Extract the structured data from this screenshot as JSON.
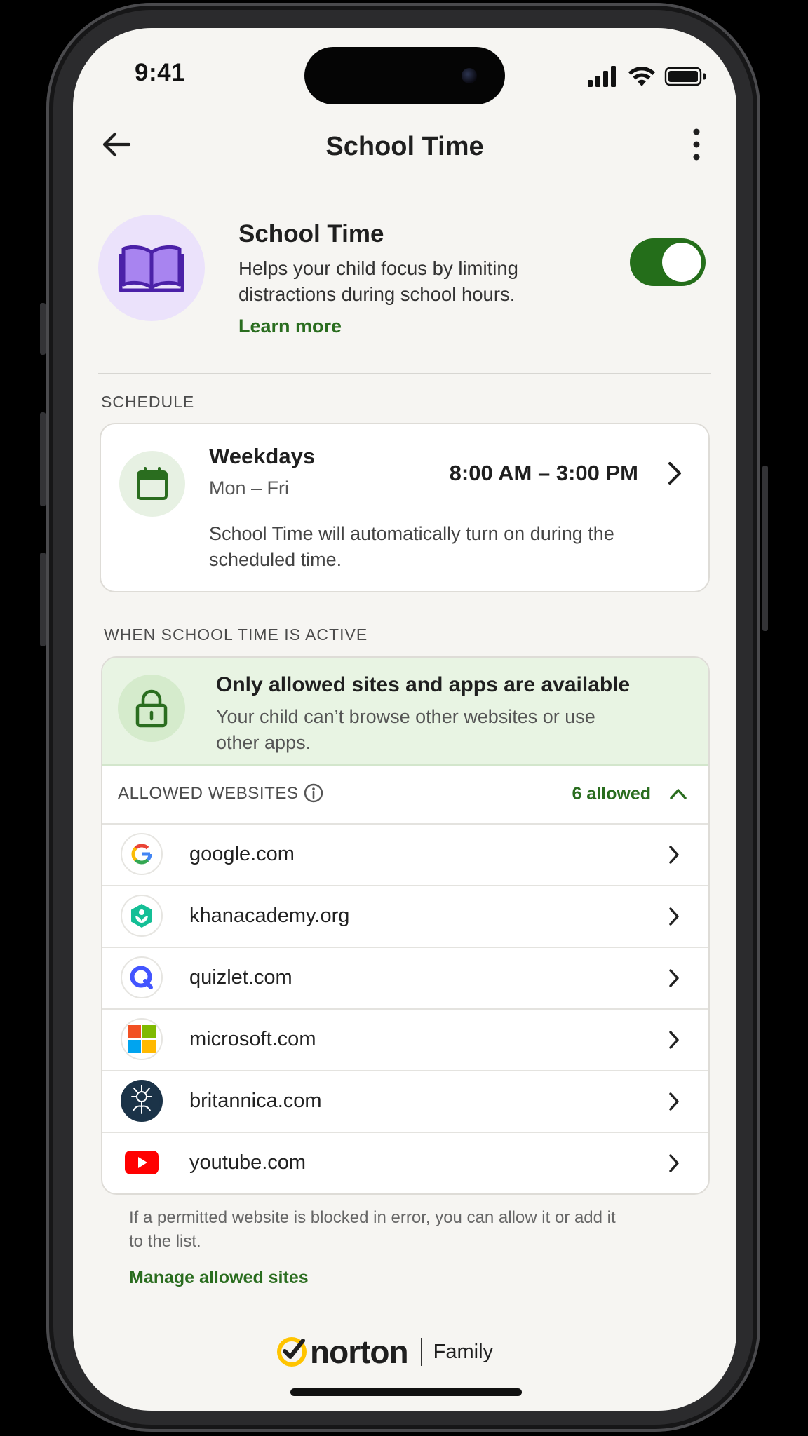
{
  "status_bar": {
    "time": "9:41"
  },
  "nav": {
    "title": "School Time"
  },
  "hero": {
    "title": "School Time",
    "description": "Helps your child focus by limiting distractions during school hours.",
    "learn_more": "Learn more",
    "toggle_on": true,
    "icon": "book-icon"
  },
  "schedule": {
    "section_label": "SCHEDULE",
    "title": "Weekdays",
    "days": "Mon – Fri",
    "time_range": "8:00 AM – 3:00 PM",
    "note": "School Time will automatically turn on during the scheduled time."
  },
  "active": {
    "section_label": "WHEN SCHOOL TIME IS ACTIVE",
    "banner_title": "Only allowed sites and apps are available",
    "banner_desc": "Your child can’t browse other websites or use other apps.",
    "allowed_label": "ALLOWED WEBSITES",
    "allowed_count": "6 allowed",
    "sites": [
      {
        "name": "google.com",
        "icon": "google-logo"
      },
      {
        "name": "khanacademy.org",
        "icon": "khan-academy-logo"
      },
      {
        "name": "quizlet.com",
        "icon": "quizlet-logo"
      },
      {
        "name": "microsoft.com",
        "icon": "microsoft-logo"
      },
      {
        "name": "britannica.com",
        "icon": "britannica-logo"
      },
      {
        "name": "youtube.com",
        "icon": "youtube-logo"
      }
    ]
  },
  "footer": {
    "note": "If a permitted website is blocked in error, you can allow it or add it to the list.",
    "manage_link": "Manage allowed sites",
    "brand_name": "norton",
    "brand_product": "Family"
  },
  "colors": {
    "accent_green": "#2a6d1f",
    "toggle_green": "#246e1a",
    "banner_bg": "#e8f4e3",
    "hero_icon_bg": "#ebe2fb",
    "book_purple": "#5b2bc0",
    "norton_yellow": "#ffc400"
  }
}
